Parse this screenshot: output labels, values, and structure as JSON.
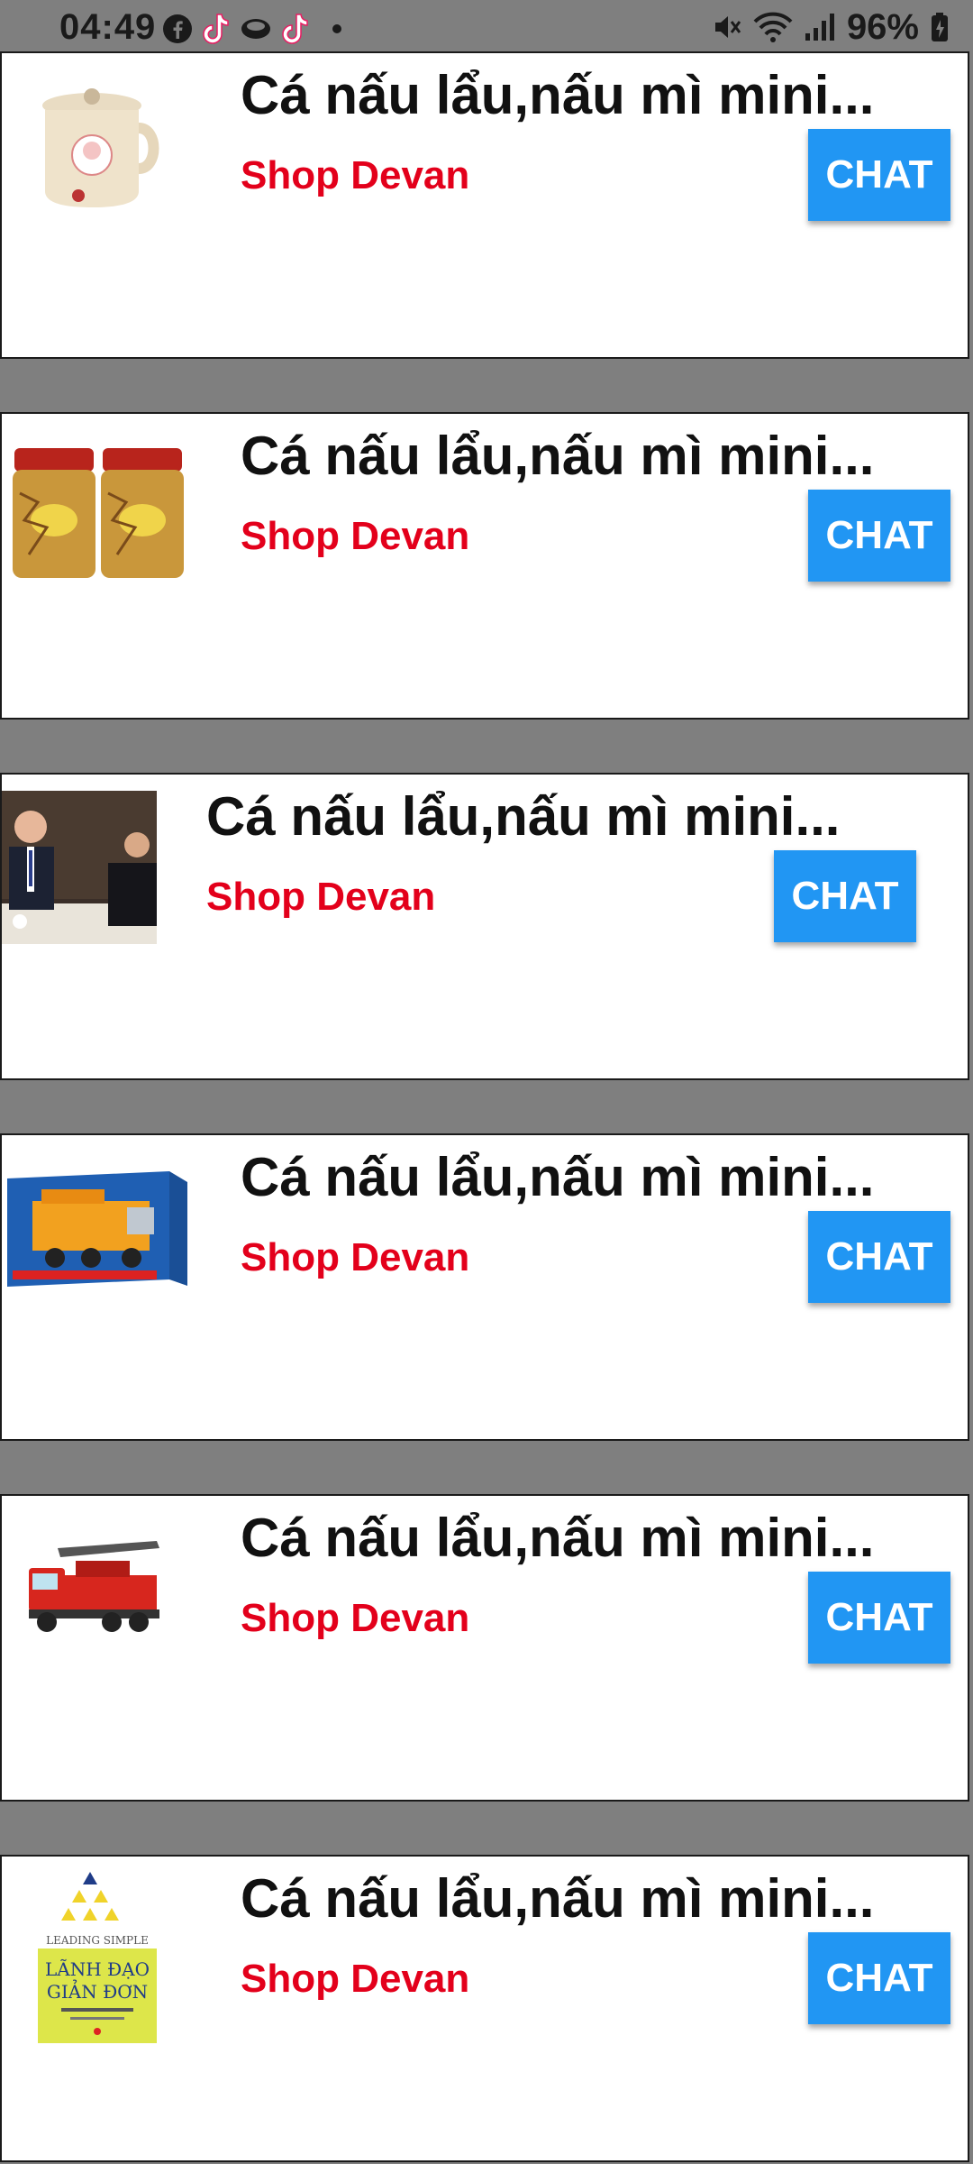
{
  "status_bar": {
    "time": "04:49",
    "battery": "96%",
    "left_icons": [
      "facebook-icon",
      "tiktok-icon",
      "messenger-icon",
      "tiktok-icon",
      "dot-icon"
    ],
    "right_icons": [
      "mute-icon",
      "wifi-icon",
      "signal-icon",
      "battery-charging-icon"
    ]
  },
  "items": [
    {
      "title": "Cá nấu lẩu,nấu mì mini...",
      "shop": "Shop Devan",
      "chat_label": "CHAT",
      "image": "electric-cooker-image"
    },
    {
      "title": "Cá nấu lẩu,nấu mì mini...",
      "shop": "Shop Devan",
      "chat_label": "CHAT",
      "image": "snack-jars-image"
    },
    {
      "title": "Cá nấu lẩu,nấu mì mini...",
      "shop": "Shop Devan",
      "chat_label": "CHAT",
      "image": "dinner-people-photo"
    },
    {
      "title": "Cá nấu lẩu,nấu mì mini...",
      "shop": "Shop Devan",
      "chat_label": "CHAT",
      "image": "toy-crane-truck-box-image"
    },
    {
      "title": "Cá nấu lẩu,nấu mì mini...",
      "shop": "Shop Devan",
      "chat_label": "CHAT",
      "image": "toy-fire-truck-image"
    },
    {
      "title": "Cá nấu lẩu,nấu mì mini...",
      "shop": "Shop Devan",
      "chat_label": "CHAT",
      "image": "book-cover-image",
      "book_text": [
        "LEADING SIMPLE",
        "LÃNH ĐẠO",
        "GIẢN ĐƠN"
      ]
    }
  ],
  "colors": {
    "background": "#7f7f7f",
    "shop_name": "#e3001b",
    "chat_button": "#2196f3"
  }
}
